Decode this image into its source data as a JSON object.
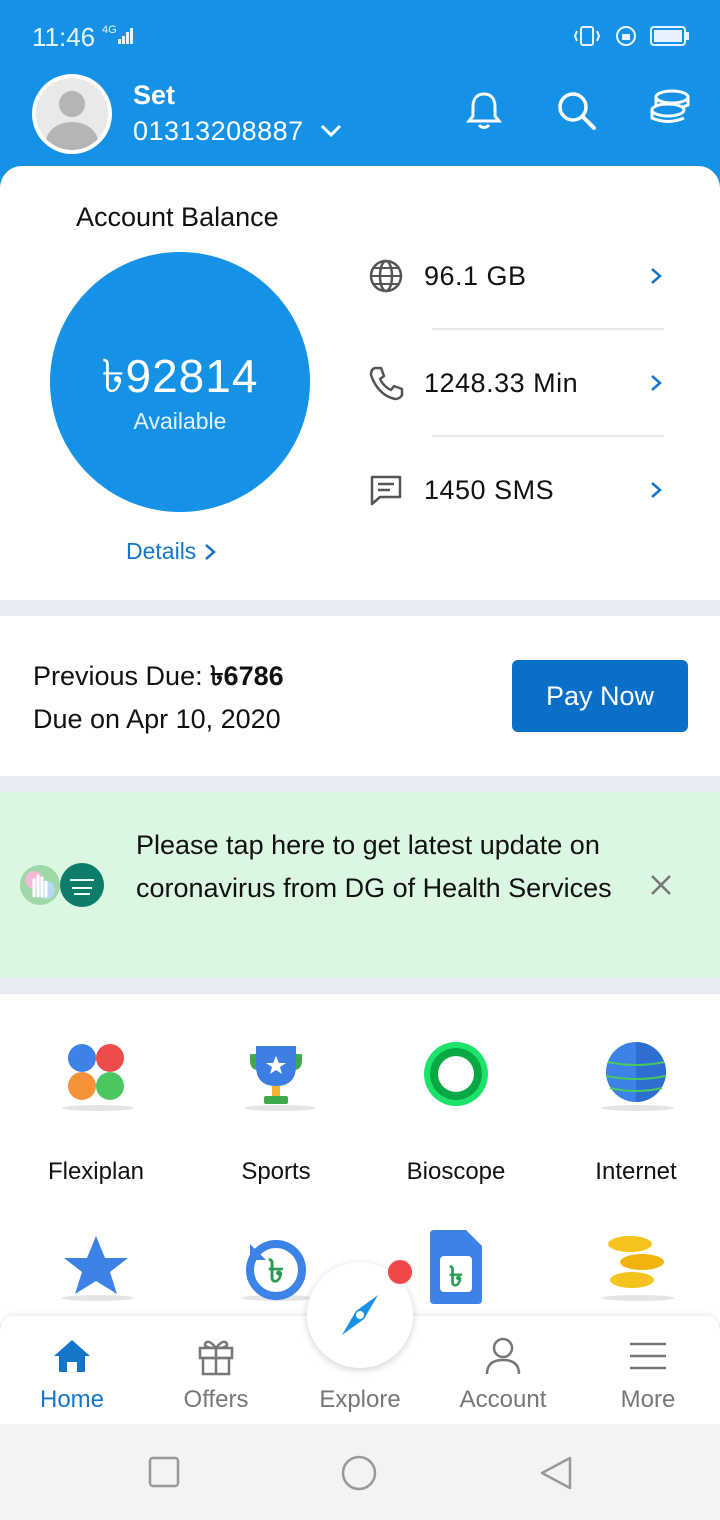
{
  "status_bar": {
    "time": "11:46",
    "network": "4G"
  },
  "header": {
    "user_name": "Set",
    "phone_number": "01313208887",
    "icons": [
      "bell-icon",
      "search-icon",
      "coins-icon"
    ]
  },
  "balance": {
    "title": "Account Balance",
    "amount": "৳92814",
    "sub_label": "Available",
    "details_label": "Details"
  },
  "usage": [
    {
      "icon": "globe-icon",
      "value": "96.1 GB"
    },
    {
      "icon": "phone-icon",
      "value": "1248.33 Min"
    },
    {
      "icon": "sms-icon",
      "value": "1450 SMS"
    }
  ],
  "due": {
    "label": "Previous Due:",
    "amount": "৳6786",
    "due_date": "Due on Apr 10, 2020",
    "pay_label": "Pay Now"
  },
  "covid_banner": {
    "text": "Please tap here to get latest update on coronavirus from DG of Health Services"
  },
  "services": [
    {
      "label": "Flexiplan",
      "icon": "flexiplan-icon"
    },
    {
      "label": "Sports",
      "icon": "trophy-icon"
    },
    {
      "label": "Bioscope",
      "icon": "bioscope-icon"
    },
    {
      "label": "Internet",
      "icon": "globe-icon"
    }
  ],
  "services_row2_icons": [
    "star-icon",
    "recharge-icon",
    "sim-icon",
    "coins-icon"
  ],
  "nav": [
    {
      "label": "Home",
      "active": true
    },
    {
      "label": "Offers",
      "active": false
    },
    {
      "label": "Explore",
      "active": false
    },
    {
      "label": "Account",
      "active": false
    },
    {
      "label": "More",
      "active": false
    }
  ],
  "colors": {
    "primary": "#1592e6",
    "accent": "#0a6fc7",
    "link": "#1576c9",
    "banner_bg": "#dcf7e1"
  }
}
